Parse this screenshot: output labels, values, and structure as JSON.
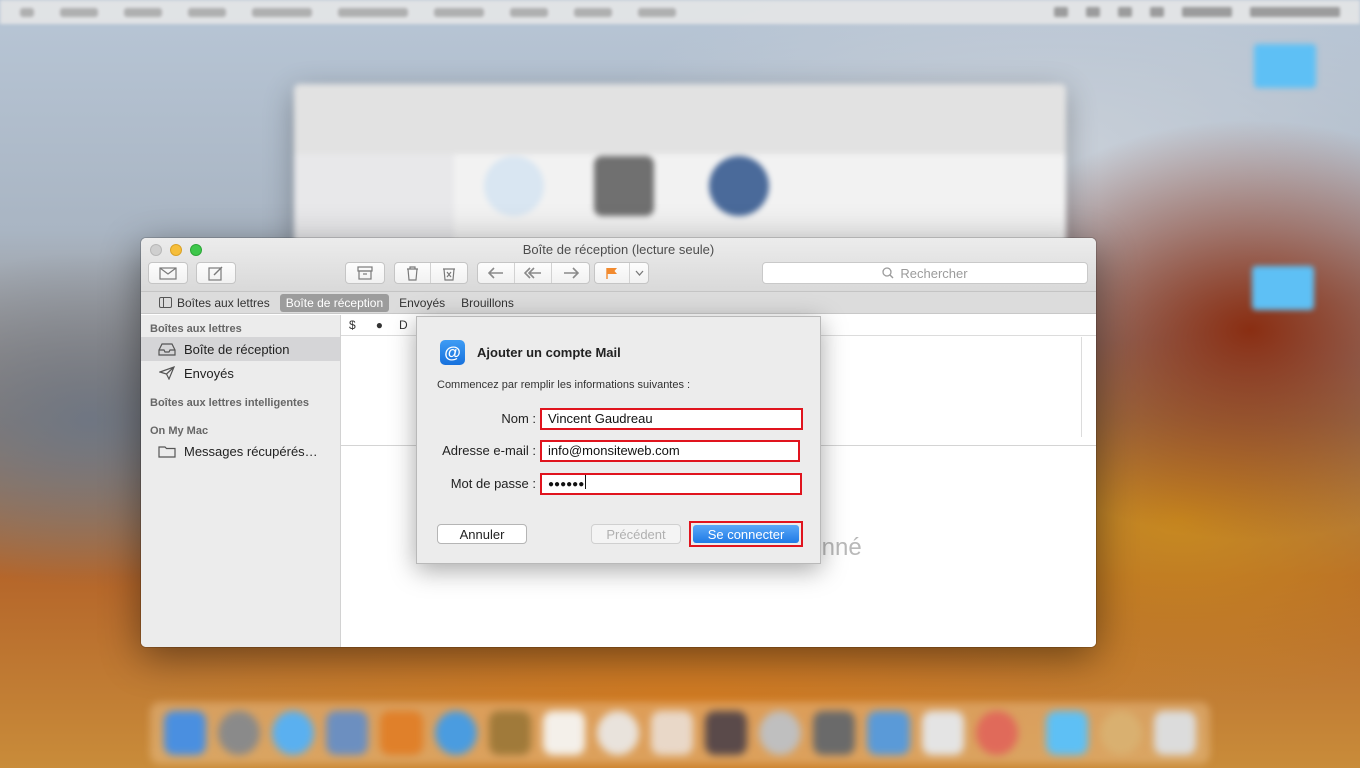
{
  "window": {
    "title": "Boîte de réception (lecture seule)"
  },
  "toolbar": {
    "search_placeholder": "Rechercher"
  },
  "favorites": {
    "mailboxes": "Boîtes aux lettres",
    "inbox": "Boîte de réception",
    "sent": "Envoyés",
    "drafts": "Brouillons"
  },
  "sidebar": {
    "section_mailboxes": "Boîtes aux lettres",
    "inbox": "Boîte de réception",
    "sent": "Envoyés",
    "section_smart": "Boîtes aux lettres intelligentes",
    "section_on_my_mac": "On My Mac",
    "recovered": "Messages récupérés…"
  },
  "list_header": {
    "col_attachment": "$",
    "col_unread": "●",
    "col_from": "D"
  },
  "preview": {
    "partial_message": "ionné"
  },
  "dialog": {
    "title": "Ajouter un compte Mail",
    "subtitle": "Commencez par remplir les informations suivantes :",
    "name_label": "Nom :",
    "name_value": "Vincent Gaudreau",
    "email_label": "Adresse e-mail :",
    "email_value": "info@monsiteweb.com",
    "password_label": "Mot de passe :",
    "password_value": "●●●●●●",
    "cancel_label": "Annuler",
    "previous_label": "Précédent",
    "connect_label": "Se connecter"
  },
  "colors": {
    "highlight_red": "#e0141e",
    "accent_blue": "#1f7ae6"
  },
  "icons": {
    "dialog_icon": "at-sign-icon"
  }
}
